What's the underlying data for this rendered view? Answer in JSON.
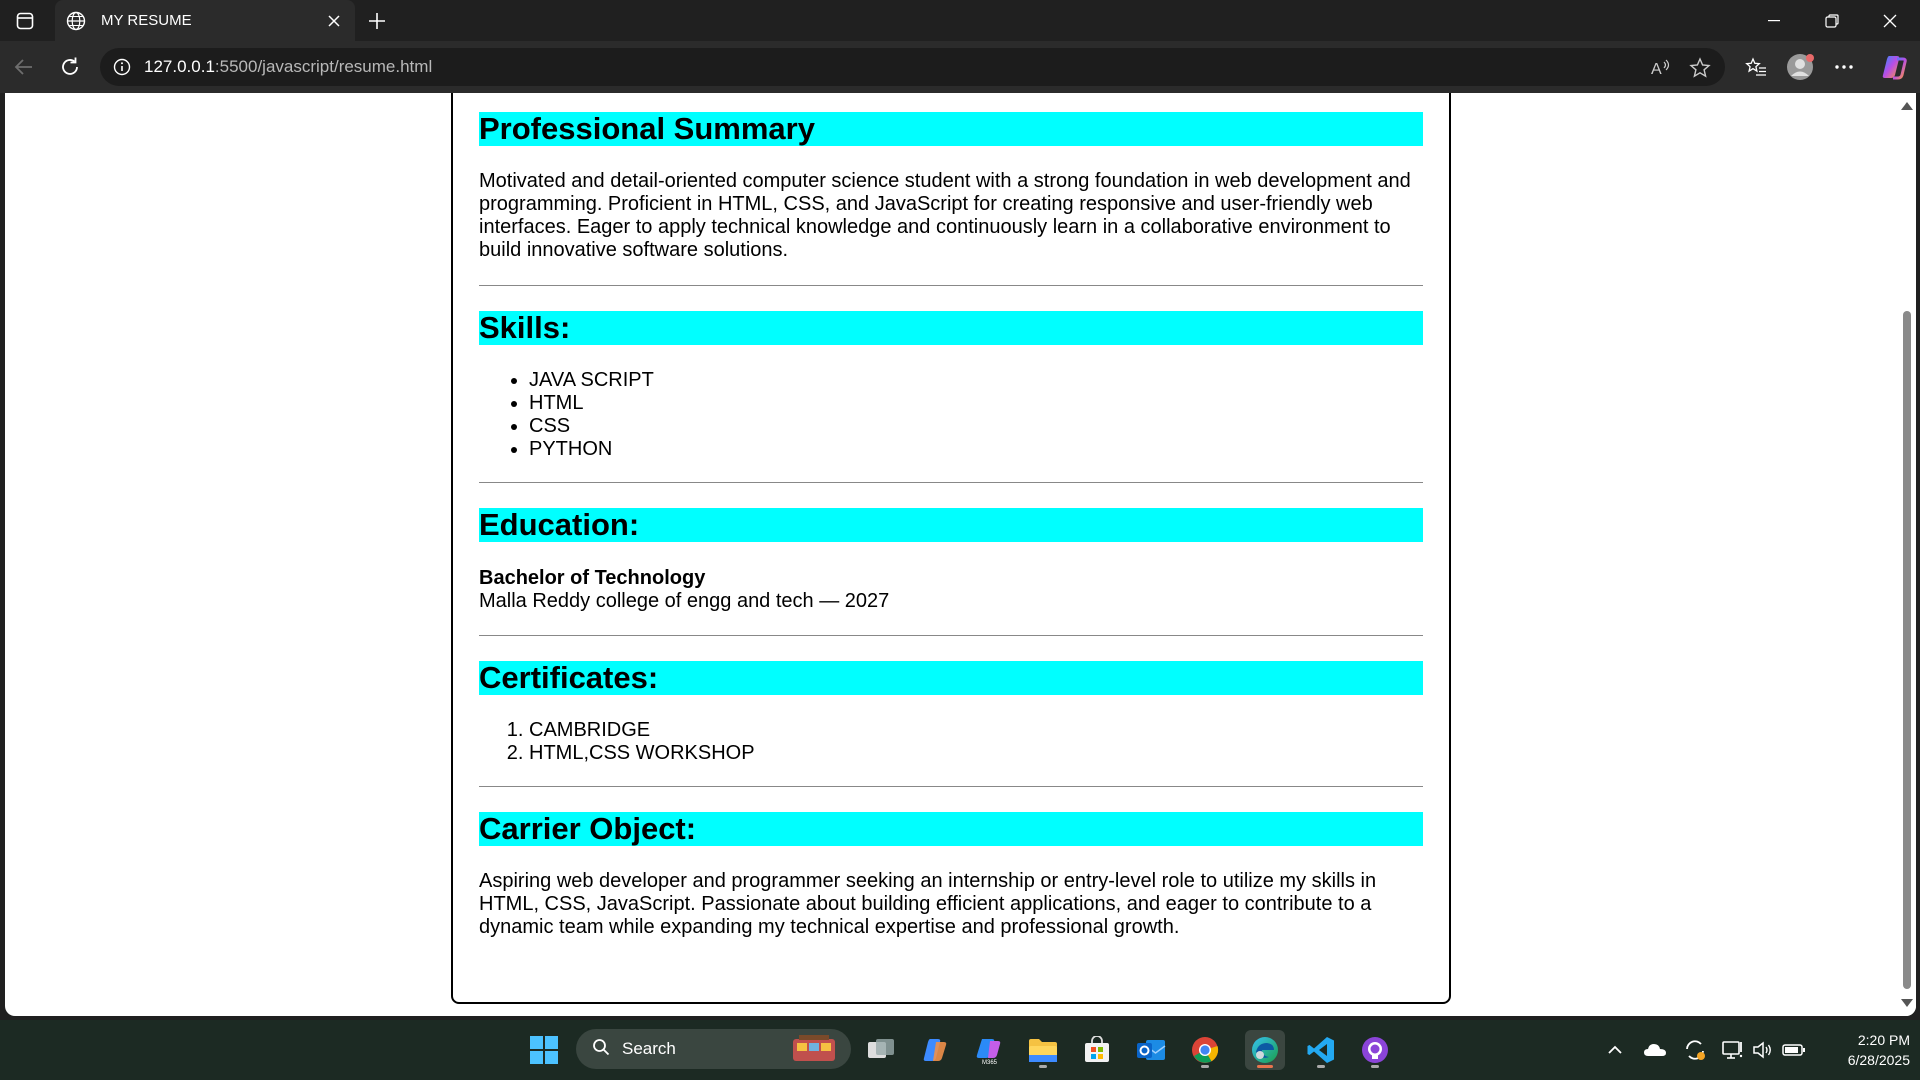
{
  "browser": {
    "tab_title": "MY RESUME",
    "url_host": "127.0.0.1",
    "url_path": ":5500/javascript/resume.html"
  },
  "resume": {
    "summary_heading": "Professional Summary",
    "summary_text": "Motivated and detail-oriented computer science student with a strong foundation in web development and programming. Proficient in HTML, CSS, and JavaScript for creating responsive and user-friendly web interfaces. Eager to apply technical knowledge and continuously learn in a collaborative environment to build innovative software solutions.",
    "skills_heading": "Skills:",
    "skills": [
      "JAVA SCRIPT",
      "HTML",
      "CSS",
      "PYTHON"
    ],
    "education_heading": "Education:",
    "education_degree": "Bachelor of Technology",
    "education_college": "Malla Reddy college of engg and tech — 2027",
    "certificates_heading": "Certificates:",
    "certificates": [
      "CAMBRIDGE",
      "HTML,CSS WORKSHOP"
    ],
    "objective_heading": "Carrier Object:",
    "objective_text": "Aspiring web developer and programmer seeking an internship or entry-level role to utilize my skills in HTML, CSS, JavaScript. Passionate about building efficient applications, and eager to contribute to a dynamic team while expanding my technical expertise and professional growth."
  },
  "taskbar": {
    "search_label": "Search",
    "time": "2:20 PM",
    "date": "6/28/2025"
  },
  "colors": {
    "heading_bg": "#00ffff",
    "taskbar_bg": "#1c2a23",
    "chrome_bg": "#202020"
  }
}
